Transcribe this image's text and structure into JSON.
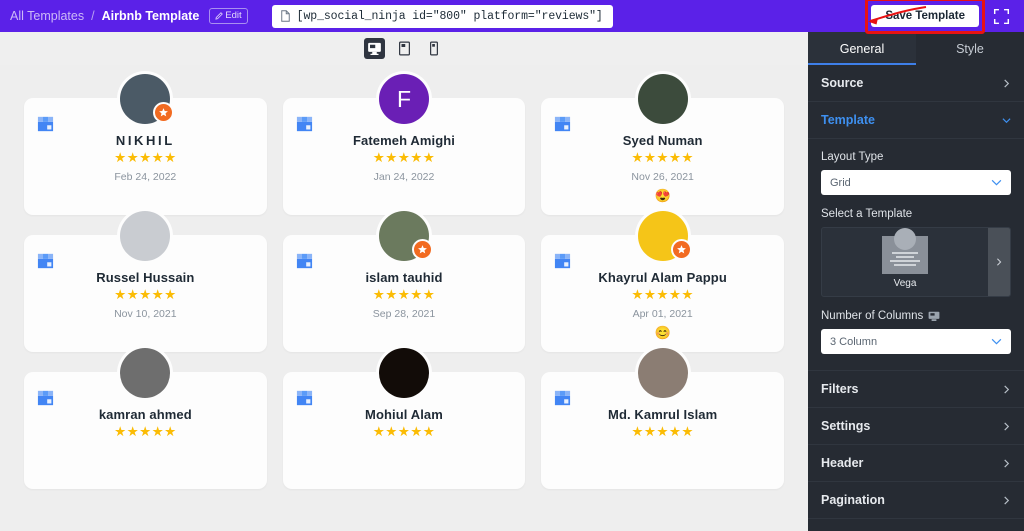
{
  "topbar": {
    "breadcrumb_root": "All Templates",
    "breadcrumb_separator": "/",
    "breadcrumb_current": "Airbnb Template",
    "edit_label": "Edit",
    "edit_icon": "pencil-icon",
    "shortcode_icon": "document-icon",
    "shortcode": "[wp_social_ninja id=\"800\" platform=\"reviews\"]",
    "save_label": "Save Template",
    "expand_icon": "fullscreen-icon",
    "highlight_color": "#e81212",
    "bar_color": "#5b21e8"
  },
  "devices": [
    {
      "name": "desktop-view",
      "icon": "desktop-icon",
      "active": true
    },
    {
      "name": "tablet-view",
      "icon": "tablet-icon",
      "active": false
    },
    {
      "name": "mobile-view",
      "icon": "mobile-icon",
      "active": false
    }
  ],
  "reviews": [
    {
      "name": "NIKHIL",
      "stars": "★★★★★",
      "rating": 5,
      "date": "Feb 24, 2022",
      "emoji": "",
      "avatar_type": "photo",
      "avatar_color": "#4b5a66",
      "initial": "",
      "has_provider_dot": true,
      "source_icon": "google-business-icon"
    },
    {
      "name": "Fatemeh Amighi",
      "stars": "★★★★★",
      "rating": 5,
      "date": "Jan 24, 2022",
      "emoji": "",
      "avatar_type": "initial",
      "avatar_color": "#6a1fb5",
      "initial": "F",
      "has_provider_dot": false,
      "source_icon": "google-business-icon"
    },
    {
      "name": "Syed Numan",
      "stars": "★★★★★",
      "rating": 5,
      "date": "Nov 26, 2021",
      "emoji": "😍",
      "avatar_type": "photo",
      "avatar_color": "#3c4b3c",
      "initial": "",
      "has_provider_dot": false,
      "source_icon": "google-business-icon"
    },
    {
      "name": "Russel Hussain",
      "stars": "★★★★★",
      "rating": 5,
      "date": "Nov 10, 2021",
      "emoji": "",
      "avatar_type": "photo",
      "avatar_color": "#c9ccd1",
      "initial": "",
      "has_provider_dot": false,
      "source_icon": "google-business-icon"
    },
    {
      "name": "islam tauhid",
      "stars": "★★★★★",
      "rating": 5,
      "date": "Sep 28, 2021",
      "emoji": "",
      "avatar_type": "photo",
      "avatar_color": "#6b7a5e",
      "initial": "",
      "has_provider_dot": true,
      "source_icon": "google-business-icon"
    },
    {
      "name": "Khayrul Alam Pappu",
      "stars": "★★★★★",
      "rating": 5,
      "date": "Apr 01, 2021",
      "emoji": "😊",
      "avatar_type": "photo",
      "avatar_color": "#f5c518",
      "initial": "",
      "has_provider_dot": true,
      "source_icon": "google-business-icon"
    },
    {
      "name": "kamran ahmed",
      "stars": "★★★★★",
      "rating": 5,
      "date": "",
      "emoji": "",
      "avatar_type": "photo",
      "avatar_color": "#6e6e6e",
      "initial": "",
      "has_provider_dot": false,
      "source_icon": "google-business-icon"
    },
    {
      "name": "Mohiul Alam",
      "stars": "★★★★★",
      "rating": 5,
      "date": "",
      "emoji": "",
      "avatar_type": "photo",
      "avatar_color": "#120c08",
      "initial": "",
      "has_provider_dot": false,
      "source_icon": "google-business-icon"
    },
    {
      "name": "Md. Kamrul Islam",
      "stars": "★★★★★",
      "rating": 5,
      "date": "",
      "emoji": "",
      "avatar_type": "photo",
      "avatar_color": "#8b7d73",
      "initial": "",
      "has_provider_dot": false,
      "source_icon": "google-business-icon"
    }
  ],
  "sidebar": {
    "tabs": [
      {
        "label": "General",
        "active": true
      },
      {
        "label": "Style",
        "active": false
      }
    ],
    "accent_color": "#3e90f0",
    "sections": [
      {
        "label": "Source",
        "state": "collapsed"
      },
      {
        "label": "Template",
        "state": "expanded"
      },
      {
        "label": "Filters",
        "state": "collapsed"
      },
      {
        "label": "Settings",
        "state": "collapsed"
      },
      {
        "label": "Header",
        "state": "collapsed"
      },
      {
        "label": "Pagination",
        "state": "collapsed"
      }
    ],
    "template_panel": {
      "layout_type_label": "Layout Type",
      "layout_type_value": "Grid",
      "select_template_label": "Select a Template",
      "template_name": "Vega",
      "next_icon": "chevron-right-icon",
      "columns_label": "Number of Columns",
      "columns_icon": "desktop-icon",
      "columns_value": "3 Column"
    }
  }
}
